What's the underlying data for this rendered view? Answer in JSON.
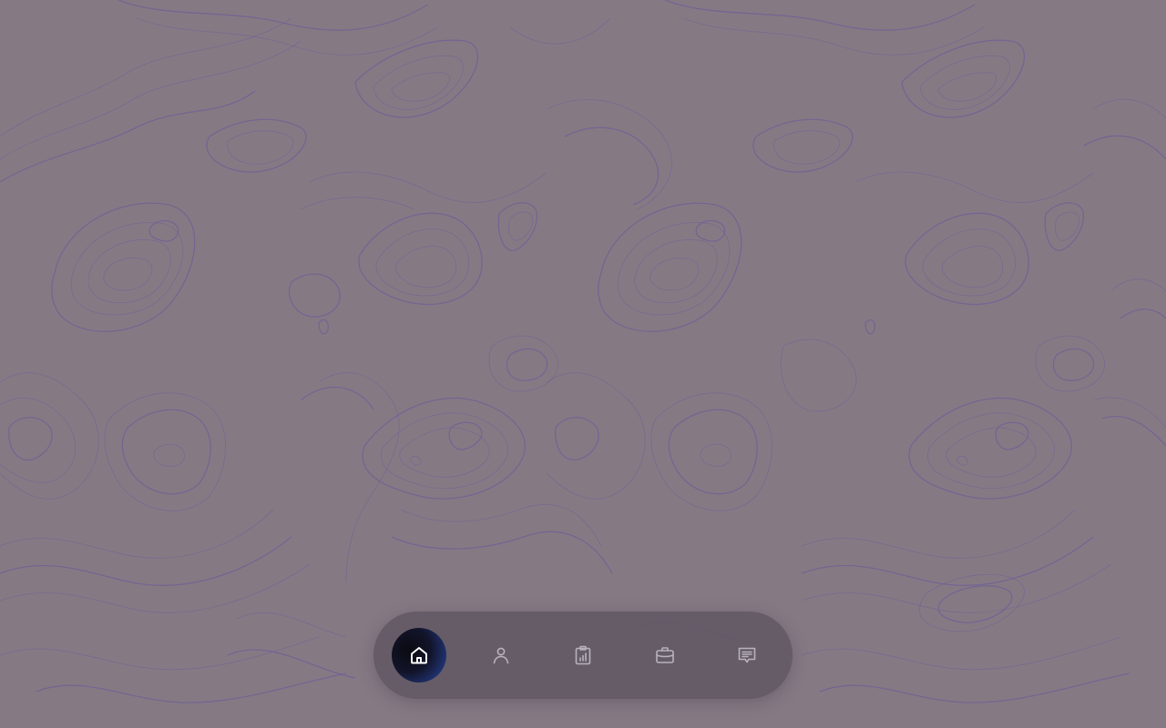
{
  "dock": {
    "items": [
      {
        "id": "home",
        "icon": "home-icon",
        "active": true
      },
      {
        "id": "profile",
        "icon": "user-icon",
        "active": false
      },
      {
        "id": "reports",
        "icon": "clipboard-chart-icon",
        "active": false
      },
      {
        "id": "portfolio",
        "icon": "briefcase-icon",
        "active": false
      },
      {
        "id": "messages",
        "icon": "message-icon",
        "active": false
      }
    ]
  },
  "colors": {
    "background": "#857a84",
    "contour_lines": "#6f5f95",
    "dock_background": "#5e5660",
    "icon_inactive": "#b8b2bc",
    "icon_active": "#ffffff",
    "active_gradient_end": "#3a5fd6"
  }
}
